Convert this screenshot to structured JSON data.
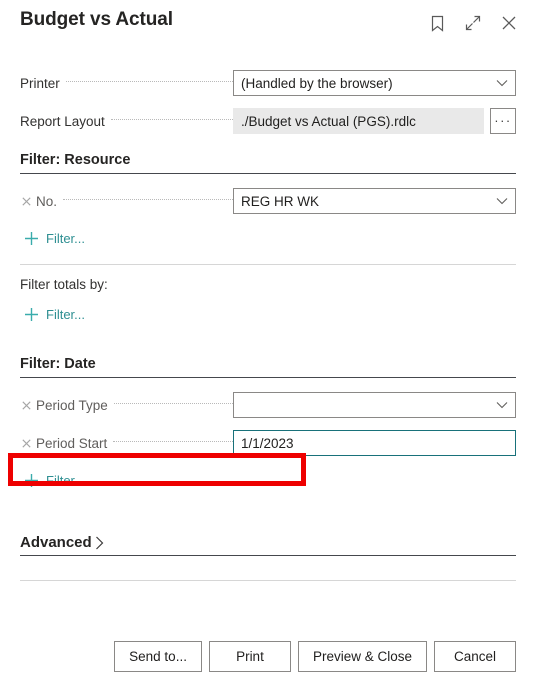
{
  "header": {
    "title": "Budget vs Actual",
    "icons": [
      {
        "name": "bookmark-icon",
        "label": "Bookmark"
      },
      {
        "name": "expand-icon",
        "label": "Expand"
      },
      {
        "name": "close-icon",
        "label": "Close"
      }
    ]
  },
  "general": {
    "printer": {
      "label": "Printer",
      "value": "(Handled by the browser)",
      "placeholder": ""
    },
    "report_layout": {
      "label": "Report Layout",
      "value": "./Budget vs Actual (PGS).rdlc",
      "ellipsis_label": "···"
    }
  },
  "filter_resource": {
    "title": "Filter: Resource",
    "fields": [
      {
        "label": "No.",
        "value": "REG HR WK"
      }
    ],
    "add_filter_label": "Filter...",
    "totals_label": "Filter totals by:",
    "totals_add_filter_label": "Filter..."
  },
  "filter_date": {
    "title": "Filter: Date",
    "fields": [
      {
        "label": "Period Type",
        "value": ""
      },
      {
        "label": "Period Start",
        "value": "1/1/2023"
      }
    ],
    "add_filter_label": "Filter..."
  },
  "advanced": {
    "label": "Advanced"
  },
  "footer": {
    "buttons": [
      {
        "name": "send-to-button",
        "label": "Send to..."
      },
      {
        "name": "print-button",
        "label": "Print"
      },
      {
        "name": "preview-and-close-button",
        "label": "Preview & Close"
      },
      {
        "name": "cancel-button",
        "label": "Cancel"
      }
    ]
  },
  "colors": {
    "accent_teal": "#2e8f92",
    "focus_border": "#18717a",
    "annotation_red": "#ee0000",
    "readonly_bg": "#e9e9e9"
  }
}
